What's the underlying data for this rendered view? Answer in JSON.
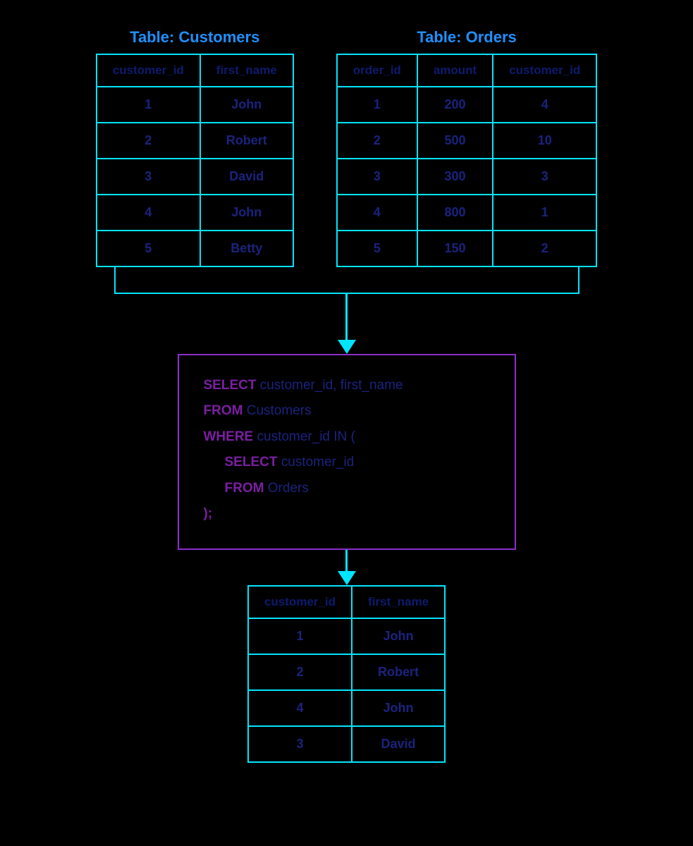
{
  "colors": {
    "background": "#000000",
    "cyan": "#00e5ff",
    "navy": "#0d1b6e",
    "purple": "#8b2fc9",
    "tableTitle": "#1e90ff"
  },
  "customers_table": {
    "title": "Table: Customers",
    "columns": [
      "customer_id",
      "first_name"
    ],
    "rows": [
      [
        "1",
        "John"
      ],
      [
        "2",
        "Robert"
      ],
      [
        "3",
        "David"
      ],
      [
        "4",
        "John"
      ],
      [
        "5",
        "Betty"
      ]
    ]
  },
  "orders_table": {
    "title": "Table: Orders",
    "columns": [
      "order_id",
      "amount",
      "customer_id"
    ],
    "rows": [
      [
        "1",
        "200",
        "4"
      ],
      [
        "2",
        "500",
        "10"
      ],
      [
        "3",
        "300",
        "3"
      ],
      [
        "4",
        "800",
        "1"
      ],
      [
        "5",
        "150",
        "2"
      ]
    ]
  },
  "sql_query": {
    "lines": [
      {
        "keyword": "SELECT",
        "rest": " customer_id, first_name"
      },
      {
        "keyword": "FROM",
        "rest": " Customers"
      },
      {
        "keyword": "WHERE",
        "rest": " customer_id IN ("
      },
      {
        "keyword": "SELECT",
        "rest": " customer_id",
        "indent": true
      },
      {
        "keyword": "FROM",
        "rest": " Orders",
        "indent": true
      },
      {
        "keyword": ");",
        "rest": "",
        "closing": true
      }
    ]
  },
  "result_table": {
    "columns": [
      "customer_id",
      "first_name"
    ],
    "rows": [
      [
        "1",
        "John"
      ],
      [
        "2",
        "Robert"
      ],
      [
        "4",
        "John"
      ],
      [
        "3",
        "David"
      ]
    ]
  }
}
